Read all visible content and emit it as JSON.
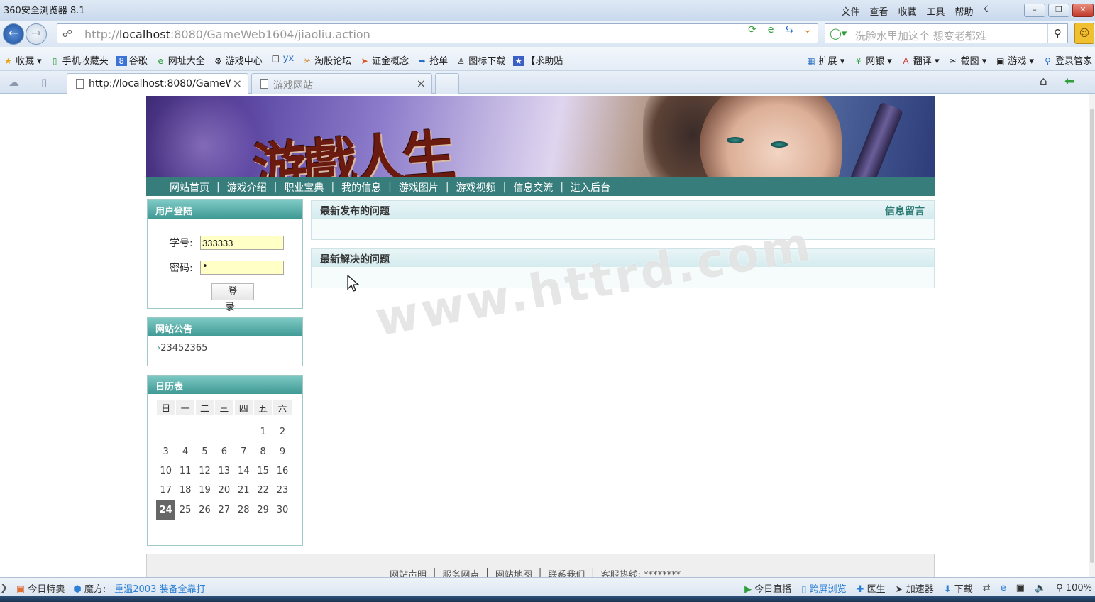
{
  "browser": {
    "title": "360安全浏览器 8.1",
    "menu": [
      "文件",
      "查看",
      "收藏",
      "工具",
      "帮助"
    ],
    "address_host_prefix": "http://",
    "address_host": "localhost",
    "address_rest": ":8080/GameWeb1604/jiaoliu.action",
    "search_placeholder": "洗脸水里加这个 想变老都难",
    "favorites": [
      "收藏",
      "手机收藏夹",
      "谷歌",
      "网址大全",
      "游戏中心",
      "yx",
      "淘股论坛",
      "证金概念",
      "抢单",
      "图标下载",
      "【求助贴"
    ],
    "favorites_right": [
      "扩展",
      "网银",
      "翻译",
      "截图",
      "游戏",
      "登录管家"
    ],
    "tabs": [
      {
        "label": "http://localhost:8080/GameW",
        "close": "×"
      },
      {
        "label": "游戏网站",
        "close": "×"
      }
    ]
  },
  "site": {
    "banner_text": "游戲人生",
    "nav": [
      "网站首页",
      "游戏介绍",
      "职业宝典",
      "我的信息",
      "游戏图片",
      "游戏视频",
      "信息交流",
      "进入后台"
    ],
    "nav_sep": "|",
    "login": {
      "title": "用户登陆",
      "id_label": "学号:",
      "id_value": "333333",
      "pwd_label": "密码:",
      "pwd_value": "•",
      "submit": "登 录"
    },
    "notice": {
      "title": "网站公告",
      "items": [
        "23452365"
      ]
    },
    "calendar": {
      "title": "日历表",
      "weekdays": [
        "日",
        "一",
        "二",
        "三",
        "四",
        "五",
        "六"
      ],
      "weeks": [
        [
          "",
          "",
          "",
          "",
          "",
          "1",
          "2"
        ],
        [
          "3",
          "4",
          "5",
          "6",
          "7",
          "8",
          "9"
        ],
        [
          "10",
          "11",
          "12",
          "13",
          "14",
          "15",
          "16"
        ],
        [
          "17",
          "18",
          "19",
          "20",
          "21",
          "22",
          "23"
        ],
        [
          "24",
          "25",
          "26",
          "27",
          "28",
          "29",
          "30"
        ]
      ],
      "today": "24"
    },
    "latest_posted": {
      "title": "最新发布的问题",
      "link": "信息留言"
    },
    "latest_solved": {
      "title": "最新解决的问题"
    },
    "footer": [
      "网站声明",
      "服务网点",
      "网站地图",
      "联系我们",
      "客服热线: ********"
    ],
    "watermark": "www.httrd.com"
  },
  "statusbar": {
    "left": [
      "今日特卖",
      "魔方:",
      "重温2003 装备全靠打"
    ],
    "right": [
      "今日直播",
      "跨屏浏览",
      "医生",
      "加速器",
      "下载",
      "100%"
    ]
  }
}
